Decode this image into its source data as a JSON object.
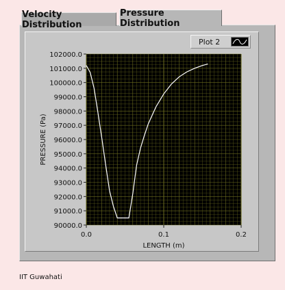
{
  "tabs": [
    {
      "label": "Velocity Distribution",
      "selected": false
    },
    {
      "label": "Pressure Distribution",
      "selected": true
    }
  ],
  "legend": {
    "label": "Plot 2"
  },
  "footer": {
    "text": "IIT Guwahati"
  },
  "colors": {
    "background": "#fbe7e7",
    "plot_area": "#000000",
    "grid": "#6b6b1e",
    "curve": "#ffffff"
  },
  "chart_data": {
    "type": "line",
    "title": "",
    "xlabel": "LENGTH (m)",
    "ylabel": "PRESSURE  (Pa)",
    "xlim": [
      0.0,
      0.2
    ],
    "ylim": [
      90000,
      102000
    ],
    "x_ticks": [
      "0.0",
      "0.1",
      "0.2"
    ],
    "y_ticks": [
      "90000.0",
      "91000.0",
      "92000.0",
      "93000.0",
      "94000.0",
      "95000.0",
      "96000.0",
      "97000.0",
      "98000.0",
      "99000.0",
      "100000.0",
      "101000.0",
      "102000.0"
    ],
    "grid": true,
    "series": [
      {
        "name": "Plot 2",
        "x": [
          0.0,
          0.005,
          0.01,
          0.015,
          0.02,
          0.025,
          0.03,
          0.035,
          0.04,
          0.045,
          0.05,
          0.055,
          0.06,
          0.065,
          0.07,
          0.075,
          0.08,
          0.09,
          0.1,
          0.11,
          0.12,
          0.13,
          0.14,
          0.15,
          0.157
        ],
        "y": [
          101200,
          100700,
          99600,
          97900,
          96100,
          94200,
          92400,
          91300,
          90500,
          90500,
          90500,
          90500,
          92200,
          94200,
          95400,
          96300,
          97100,
          98300,
          99200,
          99900,
          100400,
          100750,
          101000,
          101200,
          101300
        ]
      }
    ]
  }
}
